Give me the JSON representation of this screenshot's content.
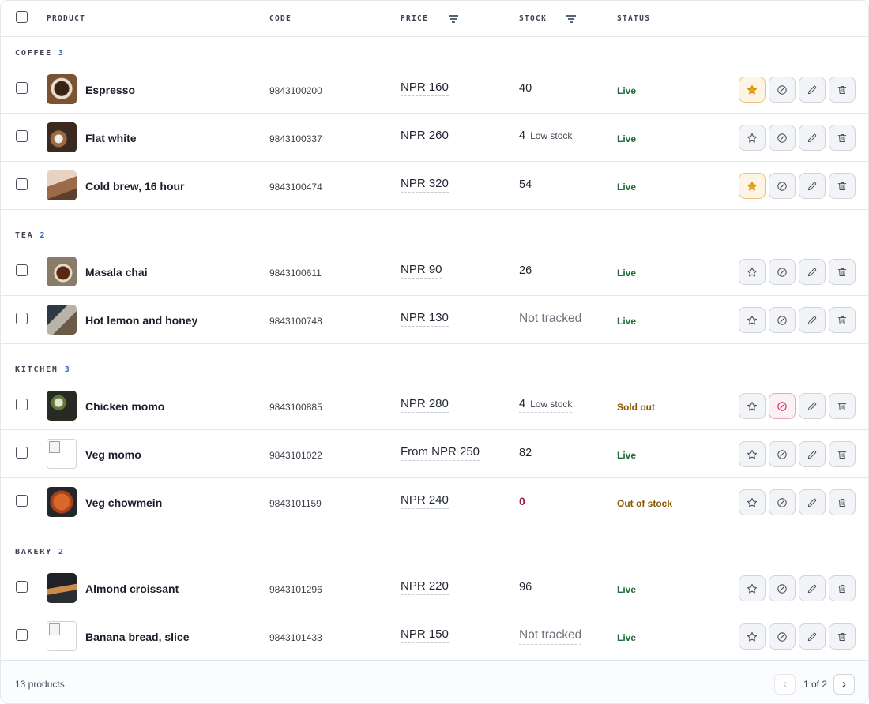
{
  "header": {
    "product": "PRODUCT",
    "code": "CODE",
    "price": "PRICE",
    "stock": "STOCK",
    "status": "STATUS"
  },
  "groups": [
    {
      "label": "COFFEE",
      "count": "3",
      "rows": [
        {
          "name": "Espresso",
          "code": "9843100200",
          "price": "NPR 160",
          "stock": "40",
          "stock_note": "",
          "status": "Live",
          "favorite": true,
          "blocked": false
        },
        {
          "name": "Flat white",
          "code": "9843100337",
          "price": "NPR 260",
          "stock": "4",
          "stock_note": "Low stock",
          "status": "Live",
          "favorite": false,
          "blocked": false
        },
        {
          "name": "Cold brew, 16 hour",
          "code": "9843100474",
          "price": "NPR 320",
          "stock": "54",
          "stock_note": "",
          "status": "Live",
          "favorite": true,
          "blocked": false
        }
      ]
    },
    {
      "label": "TEA",
      "count": "2",
      "rows": [
        {
          "name": "Masala chai",
          "code": "9843100611",
          "price": "NPR 90",
          "stock": "26",
          "stock_note": "",
          "status": "Live",
          "favorite": false,
          "blocked": false
        },
        {
          "name": "Hot lemon and honey",
          "code": "9843100748",
          "price": "NPR 130",
          "stock": "Not tracked",
          "stock_note": "",
          "status": "Live",
          "favorite": false,
          "blocked": false
        }
      ]
    },
    {
      "label": "KITCHEN",
      "count": "3",
      "rows": [
        {
          "name": "Chicken momo",
          "code": "9843100885",
          "price": "NPR 280",
          "stock": "4",
          "stock_note": "Low stock",
          "status": "Sold out",
          "favorite": false,
          "blocked": true
        },
        {
          "name": "Veg momo",
          "code": "9843101022",
          "price": "From NPR 250",
          "stock": "82",
          "stock_note": "",
          "status": "Live",
          "favorite": false,
          "blocked": false
        },
        {
          "name": "Veg chowmein",
          "code": "9843101159",
          "price": "NPR 240",
          "stock": "0",
          "stock_note": "",
          "status": "Out of stock",
          "favorite": false,
          "blocked": false
        }
      ]
    },
    {
      "label": "BAKERY",
      "count": "2",
      "rows": [
        {
          "name": "Almond croissant",
          "code": "9843101296",
          "price": "NPR 220",
          "stock": "96",
          "stock_note": "",
          "status": "Live",
          "favorite": false,
          "blocked": false
        },
        {
          "name": "Banana bread, slice",
          "code": "9843101433",
          "price": "NPR 150",
          "stock": "Not tracked",
          "stock_note": "",
          "status": "Live",
          "favorite": false,
          "blocked": false
        }
      ]
    }
  ],
  "footer": {
    "total": "13 products",
    "page_info": "1 of 2",
    "prev_label": "‹",
    "next_label": "›"
  },
  "icons": {
    "favorite": "star-icon",
    "block": "block-icon",
    "edit": "pencil-icon",
    "delete": "trash-icon"
  },
  "colors": {
    "live": "#1d6b37",
    "warning": "#8a5a00",
    "zero_stock": "#a3183e",
    "favorite": "#e6a51c",
    "group_count": "#2f64b5"
  }
}
